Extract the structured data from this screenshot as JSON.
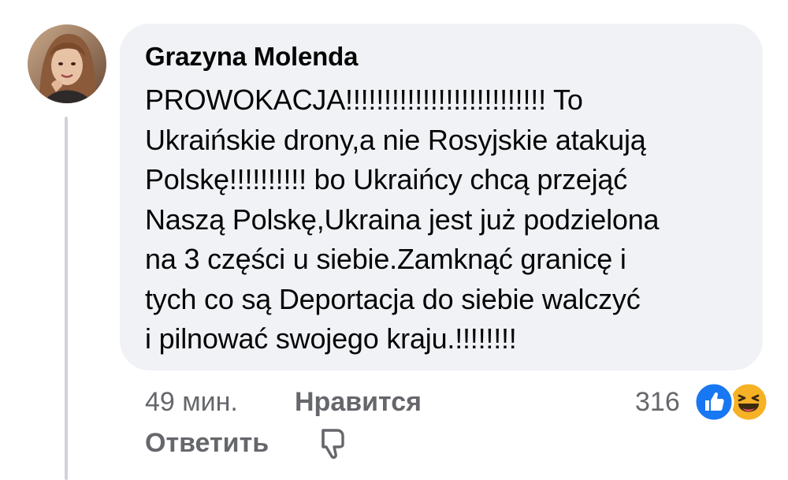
{
  "comment": {
    "author": "Grazyna Molenda",
    "text": "PROWOKACJA!!!!!!!!!!!!!!!!!!!!!!!!!! To\nUkraińskie drony,a nie Rosyjskie atakują\nPolskę!!!!!!!!!! bo Ukraińcy chcą przejąć\nNaszą Polskę,Ukraina jest już podzielona\nna 3 części u siebie.Zamknąć granicę i\ntych co są Deportacja do siebie walczyć\ni pilnować swojego kraju.!!!!!!!!"
  },
  "actions": {
    "time": "49 мин.",
    "like_label": "Нравится",
    "reply_label": "Ответить"
  },
  "reactions": {
    "count": "316",
    "types": [
      "like-icon",
      "haha-icon"
    ]
  },
  "colors": {
    "bubble": "#f0f2f5",
    "meta_text": "#65676b",
    "like_blue": "#1877f2",
    "haha_yellow": "#f7b125"
  }
}
